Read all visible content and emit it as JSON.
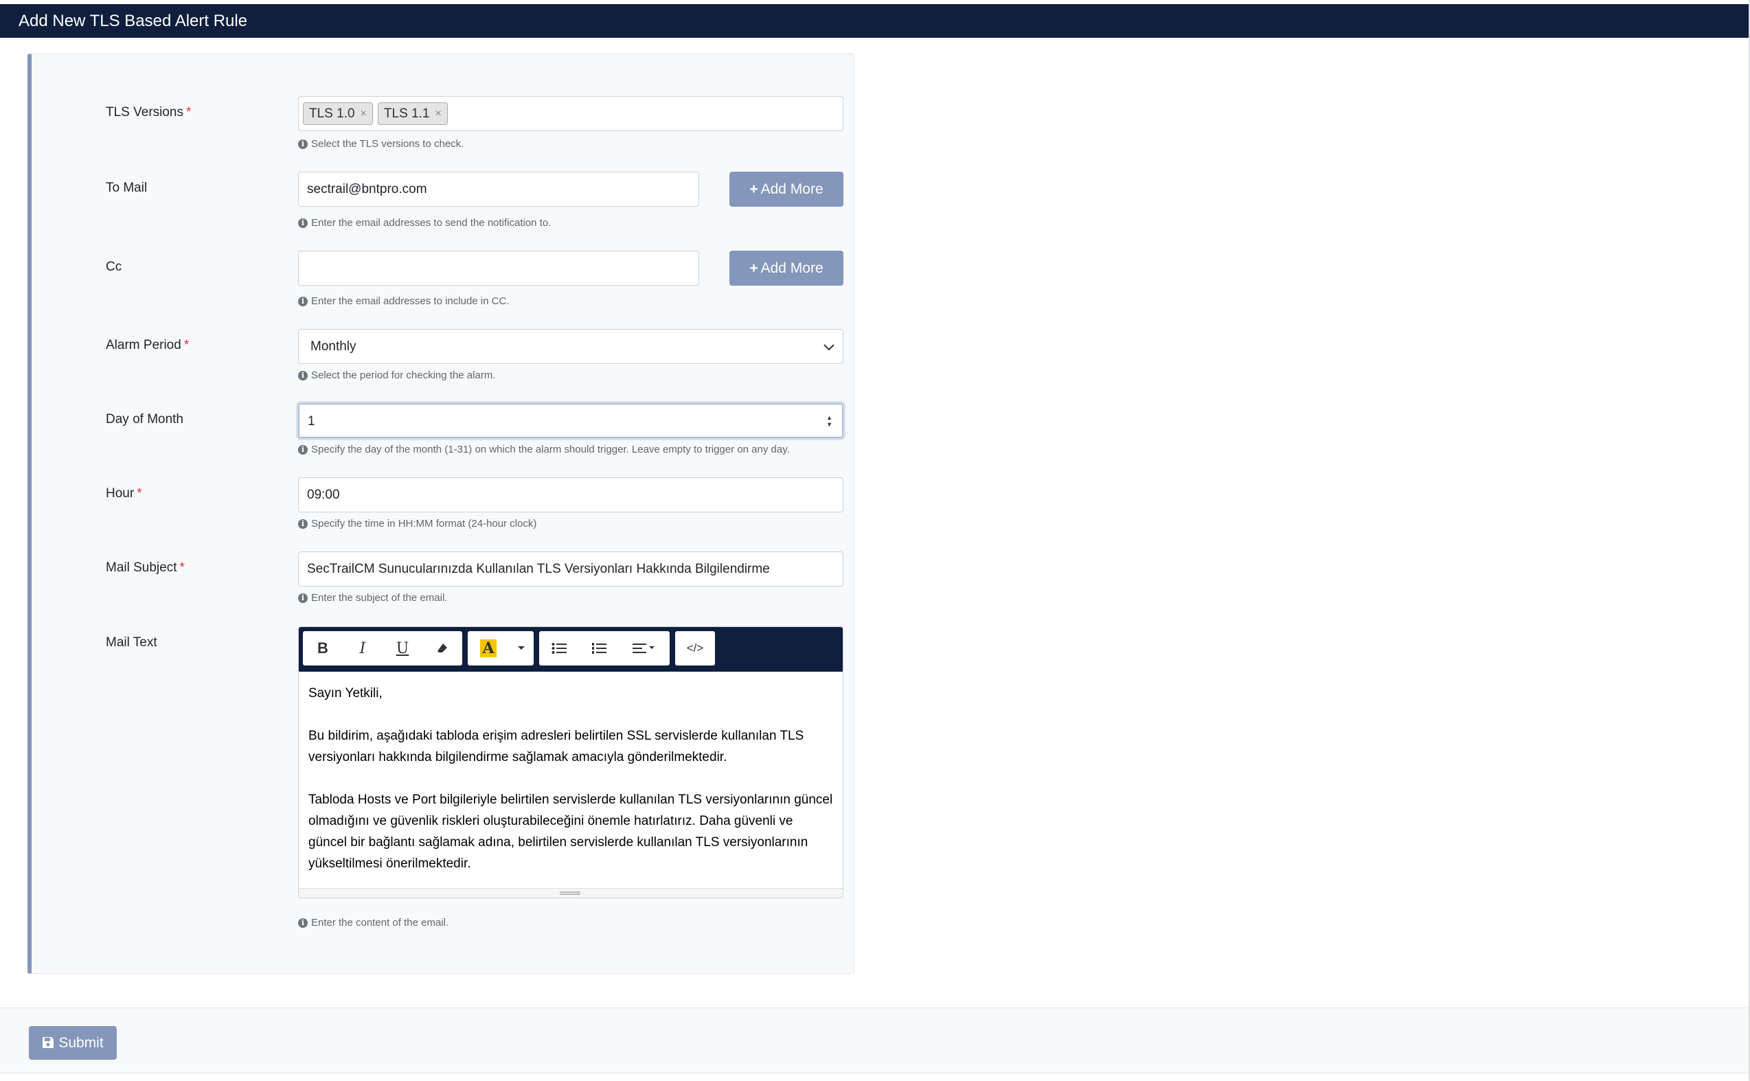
{
  "header": {
    "title": "Add New TLS Based Alert Rule"
  },
  "form": {
    "tls_versions": {
      "label": "TLS Versions",
      "required": "*",
      "tags": [
        "TLS 1.0",
        "TLS 1.1"
      ],
      "tag_remove": "×",
      "help": "Select the TLS versions to check."
    },
    "to_mail": {
      "label": "To Mail",
      "value": "sectrail@bntpro.com",
      "button": "Add More",
      "help": "Enter the email addresses to send the notification to."
    },
    "cc": {
      "label": "Cc",
      "value": "",
      "button": "Add More",
      "help": "Enter the email addresses to include in CC."
    },
    "alarm_period": {
      "label": "Alarm Period",
      "required": "*",
      "value": "Monthly",
      "help": "Select the period for checking the alarm."
    },
    "day_of_month": {
      "label": "Day of Month",
      "value": "1",
      "help": "Specify the day of the month (1-31) on which the alarm should trigger. Leave empty to trigger on any day."
    },
    "hour": {
      "label": "Hour",
      "required": "*",
      "value": "09:00",
      "help": "Specify the time in HH:MM format (24-hour clock)"
    },
    "mail_subject": {
      "label": "Mail Subject",
      "required": "*",
      "value": "SecTrailCM Sunucularınızda Kullanılan TLS Versiyonları Hakkında Bilgilendirme",
      "help": "Enter the subject of the email."
    },
    "mail_text": {
      "label": "Mail Text",
      "paragraphs": [
        "Sayın Yetkili,",
        "Bu bildirim, aşağıdaki tabloda erişim adresleri belirtilen SSL servislerde kullanılan TLS versiyonları hakkında bilgilendirme sağlamak amacıyla gönderilmektedir.",
        "Tabloda Hosts ve Port bilgileriyle belirtilen servislerde kullanılan TLS versiyonlarının güncel olmadığını ve güvenlik riskleri oluşturabileceğini önemle hatırlatırız. Daha güvenli ve güncel bir bağlantı sağlamak adına, belirtilen servislerde kullanılan TLS versiyonlarının yükseltilmesi önerilmektedir."
      ],
      "help": "Enter the content of the email.",
      "toolbar": {
        "bold": "B",
        "italic": "I",
        "underline": "U",
        "highlight": "A",
        "code": "</>"
      }
    }
  },
  "footer": {
    "submit": "Submit"
  },
  "colors": {
    "header_bg": "#0f1f3d",
    "accent": "#8496b9",
    "required": "#dc3545",
    "highlight": "#f5c400"
  }
}
